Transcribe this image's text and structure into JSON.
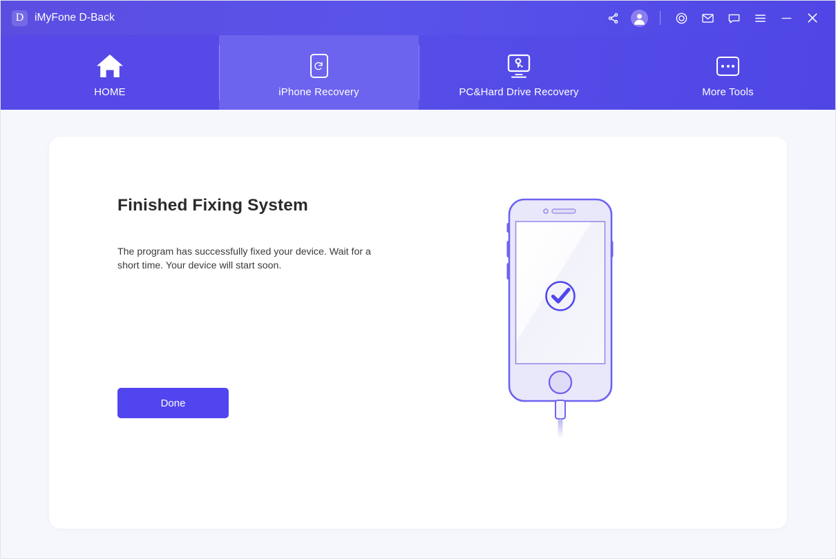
{
  "window": {
    "brand_initial": "D",
    "app_title": "iMyFone D-Back"
  },
  "titlebar_actions": [
    {
      "name": "share-icon",
      "label": "Share"
    },
    {
      "name": "account-icon",
      "label": "Account"
    },
    {
      "name": "target-icon",
      "label": "Support Center"
    },
    {
      "name": "mail-icon",
      "label": "Email"
    },
    {
      "name": "chat-icon",
      "label": "Live Chat"
    },
    {
      "name": "menu-icon",
      "label": "Menu"
    },
    {
      "name": "minimize-icon",
      "label": "Minimize"
    },
    {
      "name": "close-icon",
      "label": "Close"
    }
  ],
  "nav": {
    "tabs": [
      {
        "label": "HOME",
        "icon": "home-icon",
        "state": "active"
      },
      {
        "label": "iPhone Recovery",
        "icon": "phone-refresh-icon",
        "state": "hover"
      },
      {
        "label": "PC&Hard Drive Recovery",
        "icon": "monitor-key-icon",
        "state": "normal"
      },
      {
        "label": "More Tools",
        "icon": "more-dots-icon",
        "state": "normal"
      }
    ]
  },
  "main": {
    "title": "Finished Fixing System",
    "description": "The program has successfully fixed your device. Wait for a short time. Your device will start soon.",
    "done_label": "Done"
  },
  "illustration": {
    "name": "iphone-success-illustration",
    "status_icon": "check-circle-icon"
  },
  "colors": {
    "accent": "#5145ef",
    "titlebar": "#4f46e5",
    "tab_active": "#5748e8",
    "tab_hover": "#6c63ee",
    "page_bg": "#f5f7fc",
    "card_bg": "#ffffff",
    "phone_outline": "#6c63f0",
    "phone_body": "#e9e8fb",
    "text_dark": "#2b2b2b",
    "text_body": "#3a3a3a"
  }
}
